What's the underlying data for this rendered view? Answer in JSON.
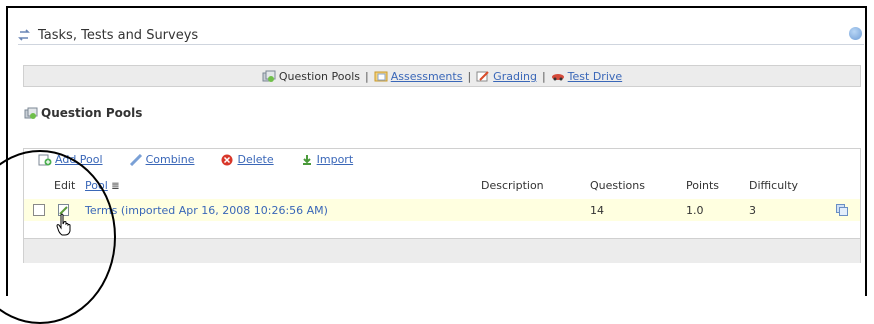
{
  "header": {
    "title": "Tasks, Tests and Surveys"
  },
  "nav": {
    "question_pools": "Question Pools",
    "separator": "|",
    "assessments": "Assessments",
    "grading": "Grading",
    "test_drive": "Test Drive"
  },
  "section": {
    "title": "Question Pools"
  },
  "toolbar": {
    "add_pool": "Add Pool",
    "combine": "Combine",
    "delete": "Delete",
    "import": "Import"
  },
  "table": {
    "headers": {
      "edit": "Edit",
      "pool": "Pool",
      "description": "Description",
      "questions": "Questions",
      "points": "Points",
      "difficulty": "Difficulty"
    },
    "rows": [
      {
        "name": "Terms (imported Apr 16, 2008 10:26:56 AM)",
        "description": "",
        "questions": "14",
        "points": "1.0",
        "difficulty": "3"
      }
    ]
  },
  "colors": {
    "link": "#3a67b8",
    "row_highlight": "#ffffe0",
    "bar": "#ececec"
  }
}
